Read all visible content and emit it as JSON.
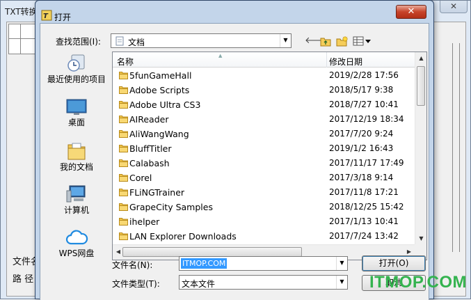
{
  "background_window": {
    "title": "TXT转换",
    "label_file": "文件名",
    "label_path": "路  径"
  },
  "dialog": {
    "title": "打开",
    "look_in_label": "查找范围(I):",
    "look_in_value": "文档",
    "places": [
      {
        "label": "最近使用的项目",
        "icon": "recent-places-icon"
      },
      {
        "label": "桌面",
        "icon": "desktop-icon"
      },
      {
        "label": "我的文档",
        "icon": "my-documents-icon"
      },
      {
        "label": "计算机",
        "icon": "computer-icon"
      },
      {
        "label": "WPS网盘",
        "icon": "wps-cloud-icon"
      }
    ],
    "columns": {
      "name": "名称",
      "modified": "修改日期"
    },
    "files": [
      {
        "name": "5funGameHall",
        "date": "2019/2/28 17:56"
      },
      {
        "name": "Adobe Scripts",
        "date": "2018/5/17 9:38"
      },
      {
        "name": "Adobe Ultra CS3",
        "date": "2018/7/27 10:41"
      },
      {
        "name": "AIReader",
        "date": "2017/12/19 18:34"
      },
      {
        "name": "AliWangWang",
        "date": "2017/7/20 9:24"
      },
      {
        "name": "BluffTitler",
        "date": "2019/1/2 16:43"
      },
      {
        "name": "Calabash",
        "date": "2017/11/17 17:49"
      },
      {
        "name": "Corel",
        "date": "2017/3/18 9:14"
      },
      {
        "name": "FLiNGTrainer",
        "date": "2017/11/8 17:21"
      },
      {
        "name": "GrapeCity Samples",
        "date": "2018/12/25 15:42"
      },
      {
        "name": "ihelper",
        "date": "2017/1/13 10:41"
      },
      {
        "name": "LAN Explorer Downloads",
        "date": "2017/7/24 13:42"
      }
    ],
    "file_name_label": "文件名(N):",
    "file_name_value": "ITMOP.COM",
    "file_type_label": "文件类型(T):",
    "file_type_value": "文本文件",
    "open_button": "打开(O)",
    "cancel_button": "取消"
  },
  "watermark": "ITMOP.COM"
}
